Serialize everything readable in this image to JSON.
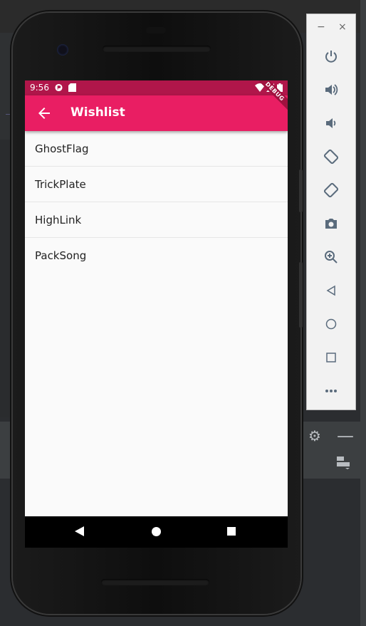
{
  "ide": {
    "gutter_text": "_b"
  },
  "emulator": {
    "window_min": "−",
    "window_close": "×",
    "controls": [
      {
        "name": "power-icon",
        "glyph": "⏻"
      },
      {
        "name": "volume-up-icon",
        "glyph": "🔊"
      },
      {
        "name": "volume-down-icon",
        "glyph": "🔉"
      },
      {
        "name": "rotate-left-icon",
        "glyph": "⟲"
      },
      {
        "name": "rotate-right-icon",
        "glyph": "⟳"
      },
      {
        "name": "camera-icon",
        "glyph": "📷"
      },
      {
        "name": "zoom-icon",
        "glyph": "⊕"
      },
      {
        "name": "back-icon",
        "glyph": "◁"
      },
      {
        "name": "home-icon",
        "glyph": "○"
      },
      {
        "name": "overview-icon",
        "glyph": "□"
      },
      {
        "name": "more-icon",
        "glyph": "•••"
      }
    ]
  },
  "device": {
    "status_bar": {
      "time": "9:56",
      "color": "#b0164a"
    },
    "debug_banner": "DEBUG",
    "app_bar": {
      "title": "Wishlist",
      "color": "#e91e63"
    },
    "wishlist": [
      "GhostFlag",
      "TrickPlate",
      "HighLink",
      "PackSong"
    ]
  }
}
